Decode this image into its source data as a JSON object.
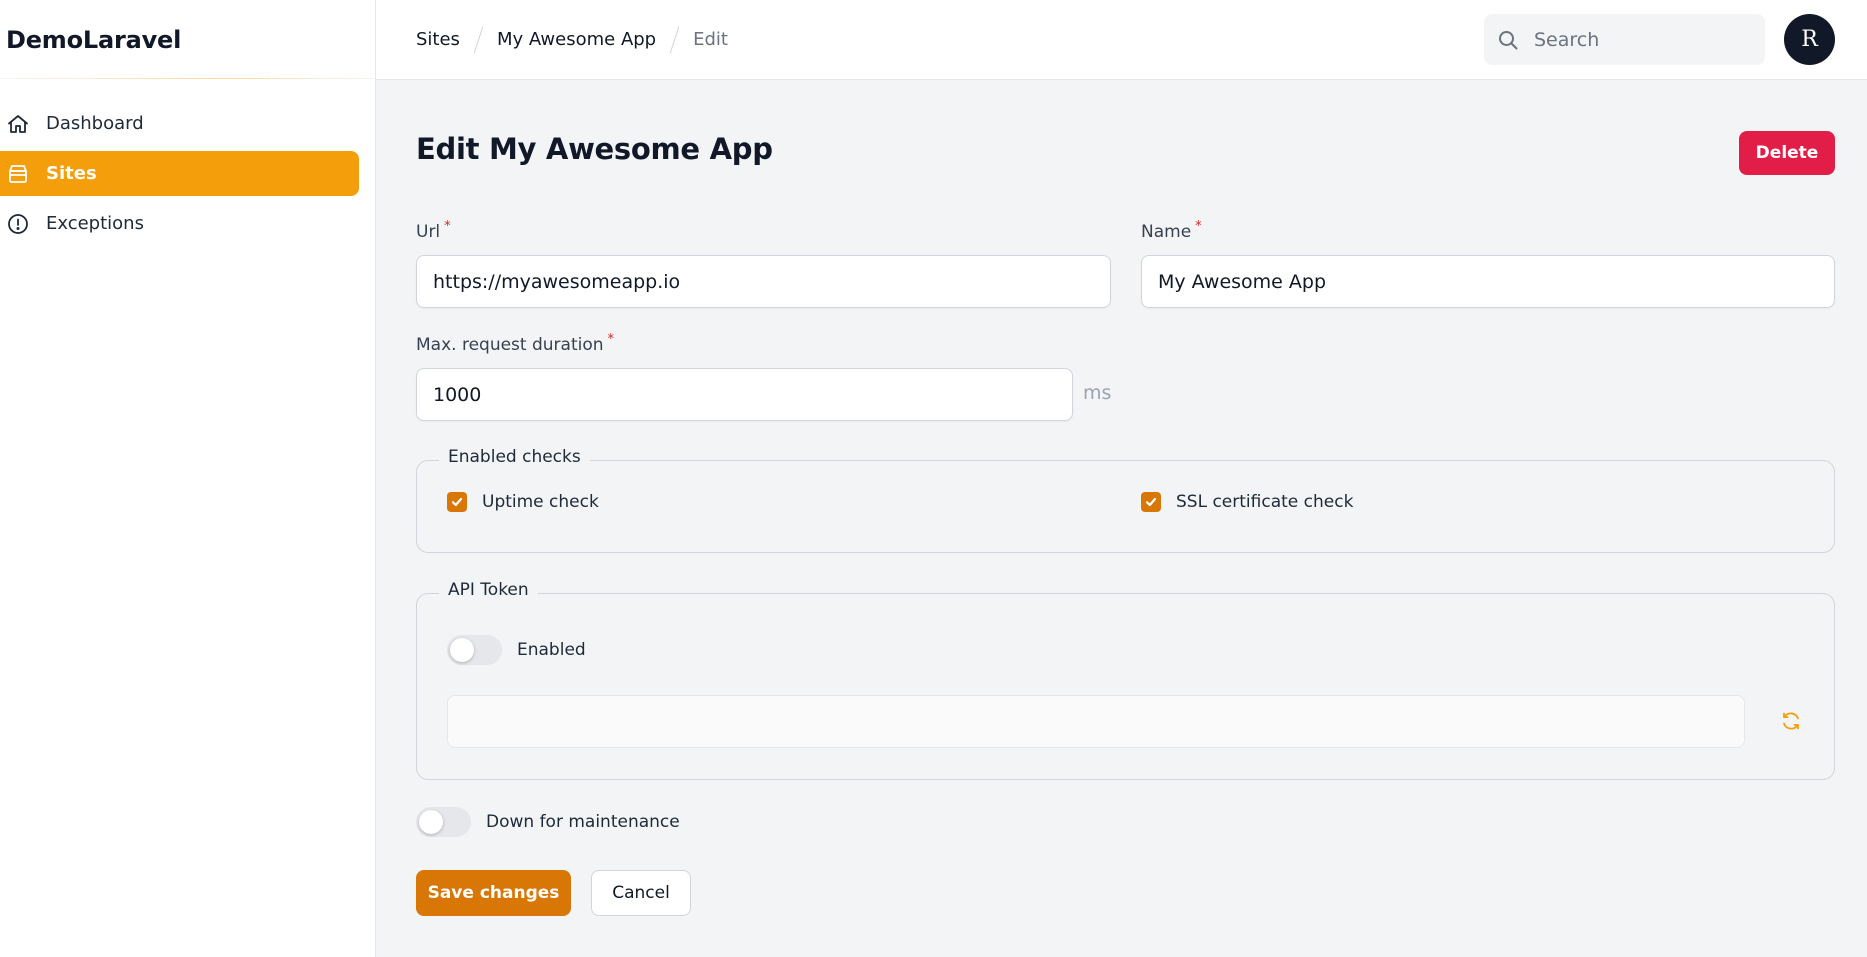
{
  "app": {
    "brand": "DemoLaravel"
  },
  "sidebar": {
    "items": [
      {
        "label": "Dashboard",
        "icon": "home-icon",
        "active": false
      },
      {
        "label": "Sites",
        "icon": "archive-box-icon",
        "active": true
      },
      {
        "label": "Exceptions",
        "icon": "exclamation-circle-icon",
        "active": false
      }
    ]
  },
  "breadcrumb": [
    "Sites",
    "My Awesome App",
    "Edit"
  ],
  "search": {
    "placeholder": "Search",
    "value": ""
  },
  "user": {
    "avatar_initial": "R"
  },
  "page": {
    "title": "Edit My Awesome App",
    "delete_label": "Delete"
  },
  "form": {
    "required_marker": "*",
    "url": {
      "label": "Url",
      "value": "https://myawesomeapp.io"
    },
    "name": {
      "label": "Name",
      "value": "My Awesome App"
    },
    "max_duration": {
      "label": "Max. request duration",
      "value": "1000",
      "suffix": "ms"
    },
    "checks": {
      "legend": "Enabled checks",
      "uptime": {
        "label": "Uptime check",
        "checked": true
      },
      "ssl": {
        "label": "SSL certificate check",
        "checked": true
      }
    },
    "api_token": {
      "legend": "API Token",
      "enabled_label": "Enabled",
      "enabled": false,
      "value": ""
    },
    "maintenance": {
      "label": "Down for maintenance",
      "enabled": false
    },
    "save_label": "Save changes",
    "cancel_label": "Cancel"
  },
  "colors": {
    "accent": "#f59e0b",
    "primary_button": "#d97706",
    "danger": "#e11d48",
    "required": "#dc2626"
  }
}
